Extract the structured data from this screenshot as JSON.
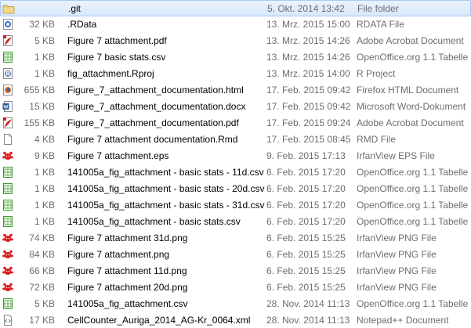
{
  "files": [
    {
      "size": "",
      "name": ".git",
      "date": "5. Okt. 2014 13:42",
      "type": "File folder",
      "icon": "folder-icon",
      "selected": true
    },
    {
      "size": "32 KB",
      "name": ".RData",
      "date": "13. Mrz. 2015 15:00",
      "type": "RDATA File",
      "icon": "rdata-file-icon"
    },
    {
      "size": "5 KB",
      "name": "Figure 7 attachment.pdf",
      "date": "13. Mrz. 2015 14:26",
      "type": "Adobe Acrobat Document",
      "icon": "pdf-file-icon"
    },
    {
      "size": "1 KB",
      "name": "Figure 7 basic stats.csv",
      "date": "13. Mrz. 2015 14:26",
      "type": "OpenOffice.org 1.1 Tabelle",
      "icon": "spreadsheet-file-icon"
    },
    {
      "size": "1 KB",
      "name": "fig_attachment.Rproj",
      "date": "13. Mrz. 2015 14:00",
      "type": "R Project",
      "icon": "rproject-file-icon"
    },
    {
      "size": "655 KB",
      "name": "Figure_7_attachment_documentation.html",
      "date": "17. Feb. 2015 09:42",
      "type": "Firefox HTML Document",
      "icon": "html-file-icon"
    },
    {
      "size": "15 KB",
      "name": "Figure_7_attachment_documentation.docx",
      "date": "17. Feb. 2015 09:42",
      "type": "Microsoft Word-Dokument",
      "icon": "word-file-icon"
    },
    {
      "size": "155 KB",
      "name": "Figure_7_attachment_documentation.pdf",
      "date": "17. Feb. 2015 09:24",
      "type": "Adobe Acrobat Document",
      "icon": "pdf-file-icon"
    },
    {
      "size": "4 KB",
      "name": "Figure 7 attachment documentation.Rmd",
      "date": "17. Feb. 2015 08:45",
      "type": "RMD File",
      "icon": "generic-file-icon"
    },
    {
      "size": "9 KB",
      "name": "Figure 7 attachment.eps",
      "date": "9. Feb. 2015 17:13",
      "type": "IrfanView EPS File",
      "icon": "irfanview-file-icon"
    },
    {
      "size": "1 KB",
      "name": "141005a_fig_attachment - basic stats - 11d.csv",
      "date": "6. Feb. 2015 17:20",
      "type": "OpenOffice.org 1.1 Tabelle",
      "icon": "spreadsheet-file-icon"
    },
    {
      "size": "1 KB",
      "name": "141005a_fig_attachment - basic stats - 20d.csv",
      "date": "6. Feb. 2015 17:20",
      "type": "OpenOffice.org 1.1 Tabelle",
      "icon": "spreadsheet-file-icon"
    },
    {
      "size": "1 KB",
      "name": "141005a_fig_attachment - basic stats - 31d.csv",
      "date": "6. Feb. 2015 17:20",
      "type": "OpenOffice.org 1.1 Tabelle",
      "icon": "spreadsheet-file-icon"
    },
    {
      "size": "1 KB",
      "name": "141005a_fig_attachment - basic stats.csv",
      "date": "6. Feb. 2015 17:20",
      "type": "OpenOffice.org 1.1 Tabelle",
      "icon": "spreadsheet-file-icon"
    },
    {
      "size": "74 KB",
      "name": "Figure 7 attachment 31d.png",
      "date": "6. Feb. 2015 15:25",
      "type": "IrfanView PNG File",
      "icon": "irfanview-file-icon"
    },
    {
      "size": "84 KB",
      "name": "Figure 7 attachment.png",
      "date": "6. Feb. 2015 15:25",
      "type": "IrfanView PNG File",
      "icon": "irfanview-file-icon"
    },
    {
      "size": "66 KB",
      "name": "Figure 7 attachment 11d.png",
      "date": "6. Feb. 2015 15:25",
      "type": "IrfanView PNG File",
      "icon": "irfanview-file-icon"
    },
    {
      "size": "72 KB",
      "name": "Figure 7 attachment 20d.png",
      "date": "6. Feb. 2015 15:25",
      "type": "IrfanView PNG File",
      "icon": "irfanview-file-icon"
    },
    {
      "size": "5 KB",
      "name": "141005a_fig_attachment.csv",
      "date": "28. Nov. 2014 11:13",
      "type": "OpenOffice.org 1.1 Tabelle",
      "icon": "spreadsheet-file-icon"
    },
    {
      "size": "17 KB",
      "name": "CellCounter_Auriga_2014_AG-Kr_0064.xml",
      "date": "28. Nov. 2014 11:13",
      "type": "Notepad++ Document",
      "icon": "xml-file-icon"
    }
  ]
}
